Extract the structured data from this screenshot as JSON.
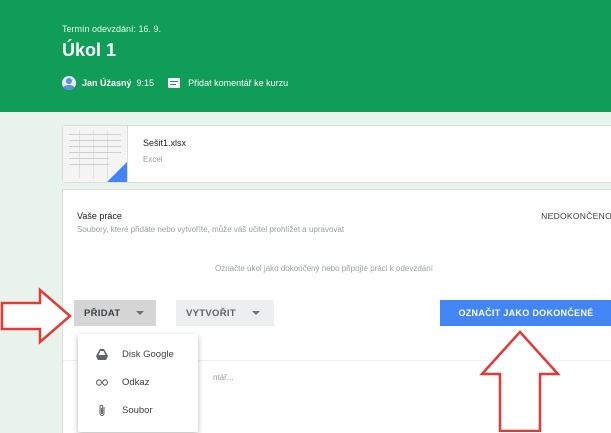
{
  "assignment": {
    "due": "Termín odevzdání: 16. 9.",
    "title": "Úkol 1",
    "author": "Jan Úžasný",
    "time": "9:15",
    "add_comment": "Přidat komentář ke kurzu"
  },
  "attachment": {
    "name": "Sešit1.xlsx",
    "type": "Excel"
  },
  "work": {
    "title": "Vaše práce",
    "subtitle": "Soubory, které přidáte nebo vytvoříte, může váš učitel prohlížet a upravovat",
    "status": "NEDOKONČENO",
    "hint": "Označte úkol jako dokončený nebo připojte práci k odevzdání",
    "add_button": "PŘIDAT",
    "create_button": "VYTVOŘIT",
    "done_button": "OZNAČIT JAKO DOKONČENÉ",
    "private_comment_partial": "ntář..."
  },
  "add_menu": {
    "items": [
      {
        "label": "Disk Google",
        "icon": "google-drive-icon"
      },
      {
        "label": "Odkaz",
        "icon": "link-icon"
      },
      {
        "label": "Soubor",
        "icon": "paperclip-icon"
      }
    ]
  },
  "colors": {
    "header_green": "#0f9d58",
    "background": "#e8f3ec",
    "primary_blue": "#4285f4",
    "annotation_red": "#e53935"
  }
}
